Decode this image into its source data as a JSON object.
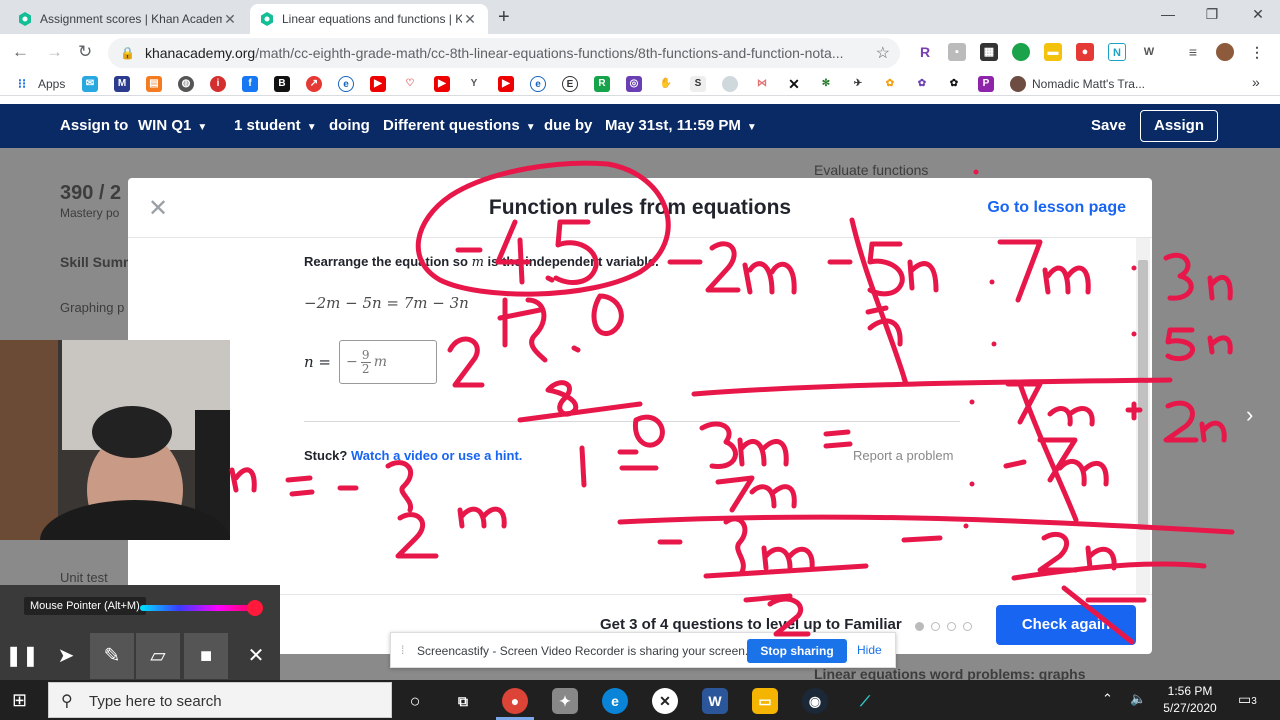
{
  "browser": {
    "tabs": [
      {
        "title": "Assignment scores | Khan Academ",
        "active": false
      },
      {
        "title": "Linear equations and functions | K",
        "active": true
      }
    ],
    "new_tab": "+",
    "window_controls": {
      "minimize": "—",
      "restore": "❐",
      "close": "✕"
    },
    "url_host": "khanacademy.org",
    "url_path": "/math/cc-eighth-grade-math/cc-8th-linear-equations-functions/8th-functions-and-function-nota...",
    "bookmarks": {
      "apps_label": "Apps",
      "last_label": "Nomadic Matt's Tra...",
      "more": "»"
    }
  },
  "assign_bar": {
    "assign_to": "Assign to",
    "class": "WIN Q1",
    "students": "1 student",
    "doing": "doing",
    "questions": "Different questions",
    "due_by": "due by",
    "due_date": "May 31st, 11:59 PM",
    "save": "Save",
    "assign": "Assign"
  },
  "background": {
    "score": "390 / 2",
    "mastery": "Mastery po",
    "skill_summary": "Skill Summ",
    "graphing": "Graphing p",
    "unit_test": "Unit test",
    "evaluate_functions": "Evaluate functions",
    "word_problems": "Linear equations word problems: graphs"
  },
  "modal": {
    "title": "Function rules from equations",
    "lesson_link": "Go to lesson page",
    "prompt_before": "Rearrange the equation so ",
    "prompt_var": "m",
    "prompt_after": " is the independent variable.",
    "equation": "−2m − 5n = 7m − 3n",
    "answer_label": "n =",
    "answer_prefix": "−",
    "answer_num": "9",
    "answer_den": "2",
    "answer_var": "m",
    "stuck": "Stuck?",
    "hint_link": "Watch a video or use a hint.",
    "report": "Report a problem",
    "level_up": "Get 3 of 4 questions to level up to Familiar",
    "progress_filled": 1,
    "progress_total": 4,
    "check_again": "Check again"
  },
  "screencastify": {
    "tooltip": "Mouse Pointer (Alt+M)",
    "share_message": "Screencastify - Screen Video Recorder is sharing your screen.",
    "stop_sharing": "Stop sharing",
    "hide": "Hide"
  },
  "taskbar": {
    "search_placeholder": "Type here to search",
    "time": "1:56 PM",
    "date": "5/27/2020",
    "notifications": "3"
  },
  "colors": {
    "ka_navy": "#0a2a66",
    "ka_blue": "#1865f2",
    "ink": "#e8174a"
  }
}
